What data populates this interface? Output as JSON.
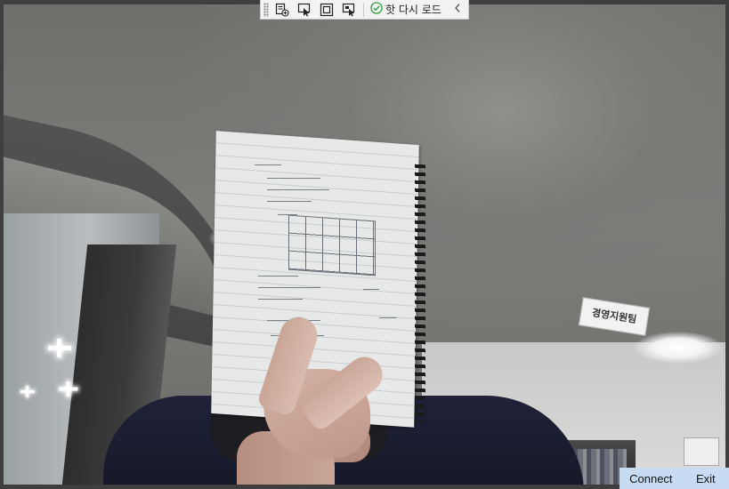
{
  "toolbar": {
    "tools": [
      {
        "name": "add-region-icon"
      },
      {
        "name": "select-pointer-icon"
      },
      {
        "name": "frame-icon"
      },
      {
        "name": "capture-icon"
      }
    ],
    "reload_label": "핫 다시 로드",
    "reload_icon": "check-circle-icon",
    "collapse_icon": "chevron-left-icon"
  },
  "scene": {
    "sign_text": "경영지원팀"
  },
  "actions": {
    "connect_label": "Connect",
    "exit_label": "Exit"
  },
  "colors": {
    "toolbar_bg": "#f3f3f3",
    "action_bar_bg": "#c7dbf2",
    "check_green": "#2e9e3b"
  }
}
